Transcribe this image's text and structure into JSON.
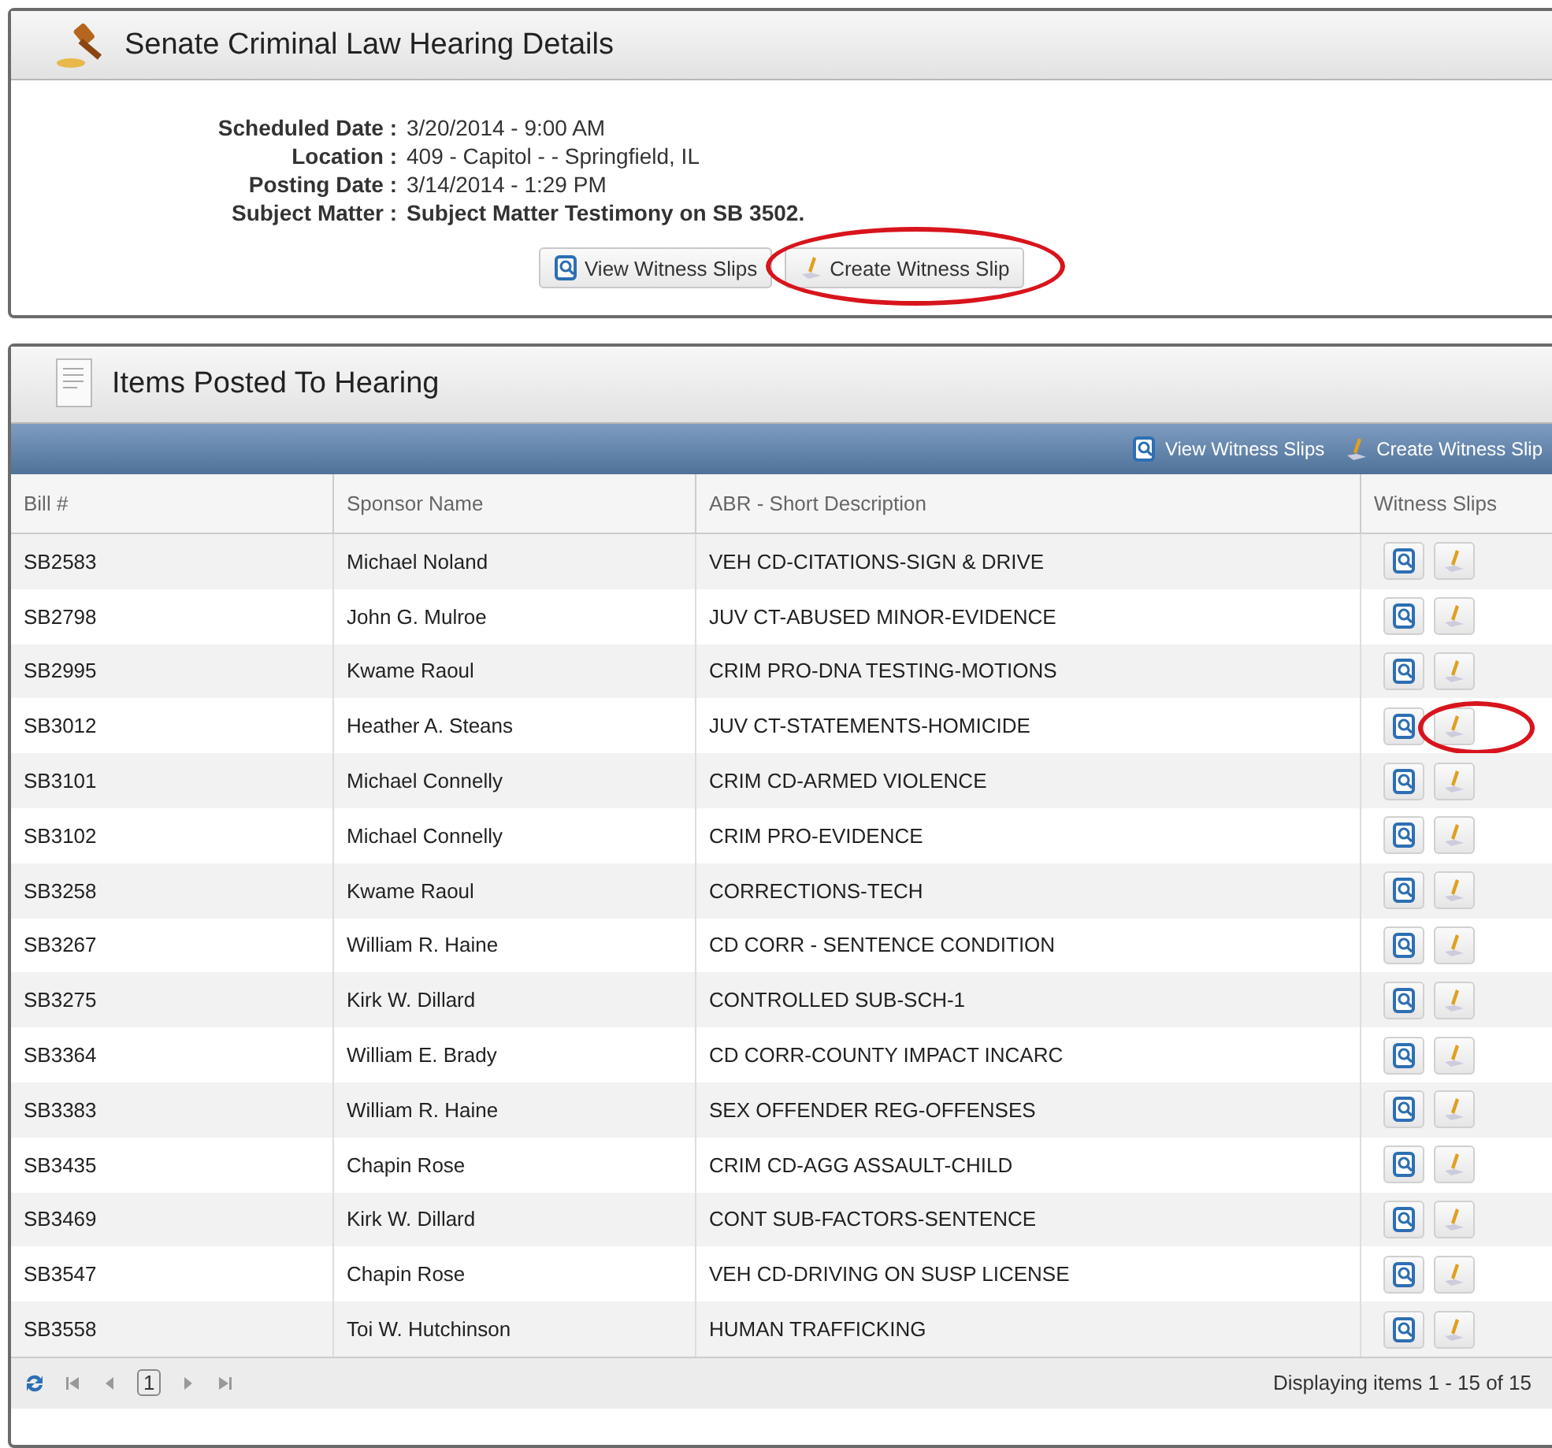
{
  "hearing_panel": {
    "title": "Senate Criminal Law Hearing Details",
    "details": [
      {
        "label": "Scheduled Date :",
        "value": "3/20/2014 - 9:00 AM",
        "bold": false
      },
      {
        "label": "Location :",
        "value": "409 - Capitol - - Springfield, IL",
        "bold": false
      },
      {
        "label": "Posting Date :",
        "value": "3/14/2014 - 1:29 PM",
        "bold": false
      },
      {
        "label": "Subject Matter :",
        "value": "Subject Matter Testimony on SB 3502.",
        "bold": true
      }
    ],
    "buttons": [
      {
        "kind": "view",
        "label": "View Witness Slips",
        "highlighted": false
      },
      {
        "kind": "create",
        "label": "Create Witness Slip",
        "highlighted": true
      }
    ]
  },
  "items_panel": {
    "title": "Items Posted To Hearing",
    "toolbar": [
      {
        "kind": "view",
        "label": "View Witness Slips"
      },
      {
        "kind": "create",
        "label": "Create Witness Slip"
      }
    ],
    "columns": [
      "Bill #",
      "Sponsor Name",
      "ABR - Short Description",
      "Witness Slips"
    ],
    "rows": [
      {
        "bill": "SB2583",
        "sponsor": "Michael Noland",
        "description": "VEH CD-CITATIONS-SIGN & DRIVE",
        "highlighted": false
      },
      {
        "bill": "SB2798",
        "sponsor": "John G. Mulroe",
        "description": "JUV CT-ABUSED MINOR-EVIDENCE",
        "highlighted": false
      },
      {
        "bill": "SB2995",
        "sponsor": "Kwame Raoul",
        "description": "CRIM PRO-DNA TESTING-MOTIONS",
        "highlighted": false
      },
      {
        "bill": "SB3012",
        "sponsor": "Heather A. Steans",
        "description": "JUV CT-STATEMENTS-HOMICIDE",
        "highlighted": true
      },
      {
        "bill": "SB3101",
        "sponsor": "Michael Connelly",
        "description": "CRIM CD-ARMED VIOLENCE",
        "highlighted": false
      },
      {
        "bill": "SB3102",
        "sponsor": "Michael Connelly",
        "description": "CRIM PRO-EVIDENCE",
        "highlighted": false
      },
      {
        "bill": "SB3258",
        "sponsor": "Kwame Raoul",
        "description": "CORRECTIONS-TECH",
        "highlighted": false
      },
      {
        "bill": "SB3267",
        "sponsor": "William R. Haine",
        "description": "CD CORR - SENTENCE CONDITION",
        "highlighted": false
      },
      {
        "bill": "SB3275",
        "sponsor": "Kirk W. Dillard",
        "description": "CONTROLLED SUB-SCH-1",
        "highlighted": false
      },
      {
        "bill": "SB3364",
        "sponsor": "William E. Brady",
        "description": "CD CORR-COUNTY IMPACT INCARC",
        "highlighted": false
      },
      {
        "bill": "SB3383",
        "sponsor": "William R. Haine",
        "description": "SEX OFFENDER REG-OFFENSES",
        "highlighted": false
      },
      {
        "bill": "SB3435",
        "sponsor": "Chapin Rose",
        "description": "CRIM CD-AGG ASSAULT-CHILD",
        "highlighted": false
      },
      {
        "bill": "SB3469",
        "sponsor": "Kirk W. Dillard",
        "description": "CONT SUB-FACTORS-SENTENCE",
        "highlighted": false
      },
      {
        "bill": "SB3547",
        "sponsor": "Chapin Rose",
        "description": "VEH CD-DRIVING ON SUSP LICENSE",
        "highlighted": false
      },
      {
        "bill": "SB3558",
        "sponsor": "Toi W. Hutchinson",
        "description": "HUMAN TRAFFICKING",
        "highlighted": false
      }
    ],
    "pager": {
      "page": "1",
      "summary": "Displaying items 1 - 15 of 15"
    }
  }
}
